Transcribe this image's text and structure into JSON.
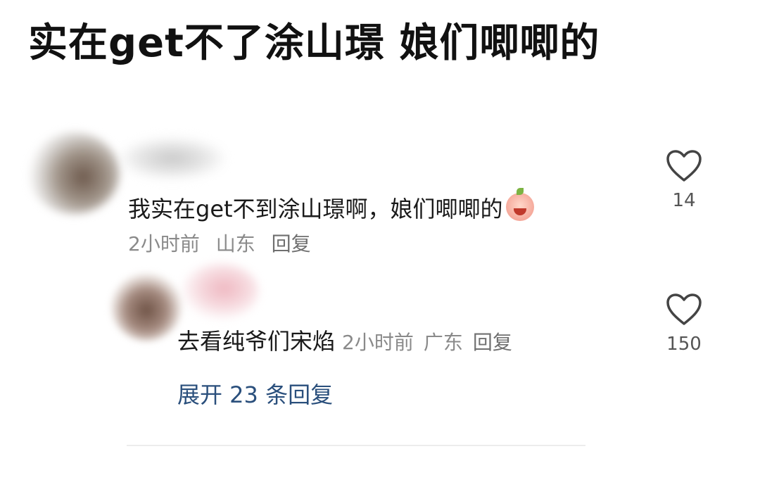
{
  "title": "实在get不了涂山璟 娘们唧唧的",
  "comments": [
    {
      "text": "我实在get不到涂山璟啊，娘们唧唧的",
      "emoji": "laughing-crying-face-icon",
      "time": "2小时前",
      "location": "山东",
      "reply_label": "回复",
      "likes": "14"
    },
    {
      "text": "去看纯爷们宋焰",
      "time": "2小时前",
      "location": "广东",
      "reply_label": "回复",
      "likes": "150",
      "expand_label": "展开 23 条回复"
    }
  ],
  "colors": {
    "text": "#1a1a1a",
    "meta": "#8a8a8a",
    "link": "#2a4f7c",
    "heart_stroke": "#444444"
  }
}
